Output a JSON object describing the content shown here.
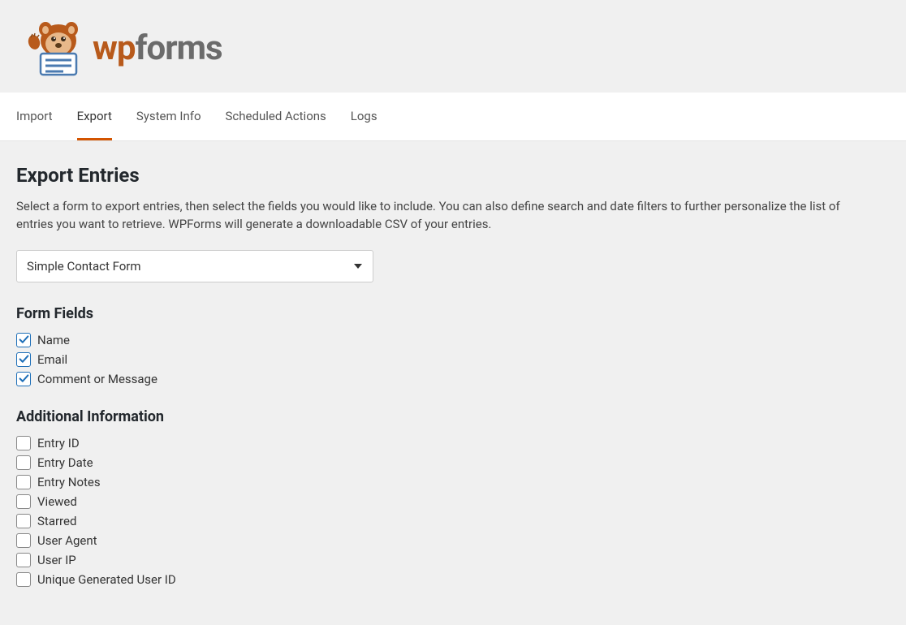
{
  "logo": {
    "part1": "wp",
    "part2": "forms"
  },
  "tabs": [
    {
      "label": "Import",
      "active": false
    },
    {
      "label": "Export",
      "active": true
    },
    {
      "label": "System Info",
      "active": false
    },
    {
      "label": "Scheduled Actions",
      "active": false
    },
    {
      "label": "Logs",
      "active": false
    }
  ],
  "page": {
    "title": "Export Entries",
    "description": "Select a form to export entries, then select the fields you would like to include. You can also define search and date filters to further personalize the list of entries you want to retrieve. WPForms will generate a downloadable CSV of your entries."
  },
  "form_select": {
    "selected": "Simple Contact Form"
  },
  "sections": {
    "form_fields_title": "Form Fields",
    "additional_info_title": "Additional Information"
  },
  "form_fields": [
    {
      "label": "Name",
      "checked": true
    },
    {
      "label": "Email",
      "checked": true
    },
    {
      "label": "Comment or Message",
      "checked": true
    }
  ],
  "additional_info": [
    {
      "label": "Entry ID",
      "checked": false
    },
    {
      "label": "Entry Date",
      "checked": false
    },
    {
      "label": "Entry Notes",
      "checked": false
    },
    {
      "label": "Viewed",
      "checked": false
    },
    {
      "label": "Starred",
      "checked": false
    },
    {
      "label": "User Agent",
      "checked": false
    },
    {
      "label": "User IP",
      "checked": false
    },
    {
      "label": "Unique Generated User ID",
      "checked": false
    }
  ]
}
